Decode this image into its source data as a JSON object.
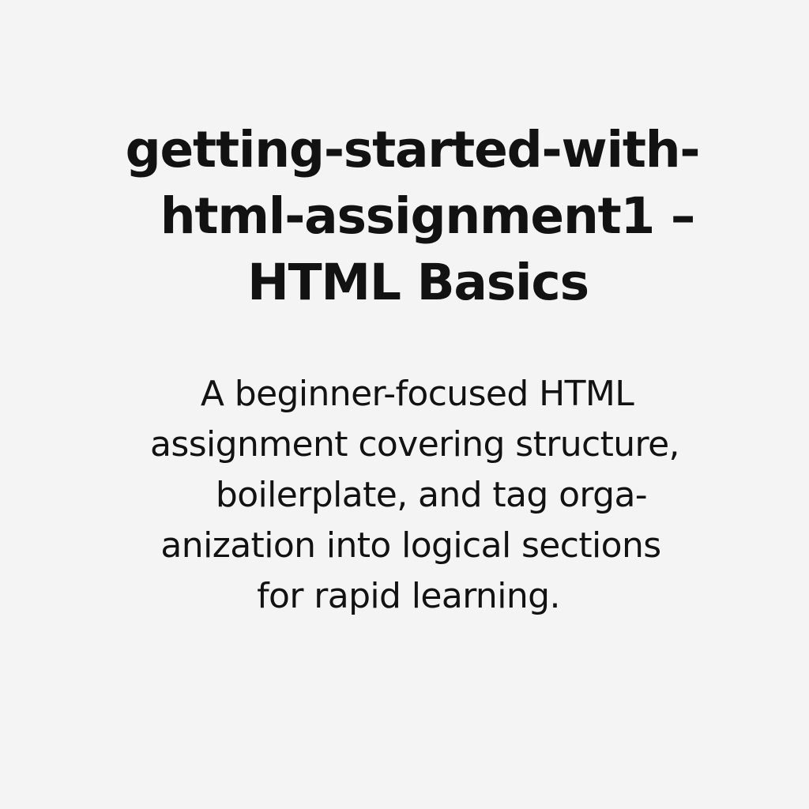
{
  "title": {
    "line1": "getting-started-with-",
    "line2": "html-assignment1 –",
    "line3": "HTML Basics"
  },
  "description": {
    "line1": "A beginner-focused HTML",
    "line2": "assignment covering structure,",
    "line3": "boilerplate, and tag orga-",
    "line4": "anization into logical sections",
    "line5": "for rapid learning."
  }
}
